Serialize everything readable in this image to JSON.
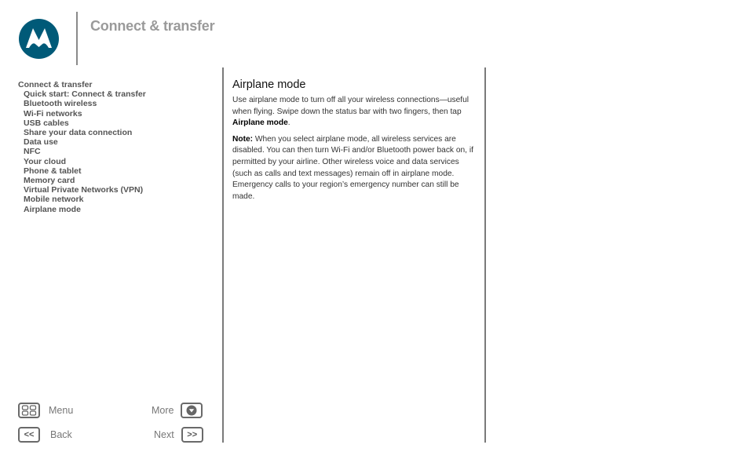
{
  "header": {
    "logo": "motorola-logo",
    "title": "Connect & transfer"
  },
  "toc": {
    "heading": "Connect & transfer",
    "items": [
      "Quick start: Connect & transfer",
      "Bluetooth wireless",
      "Wi-Fi networks",
      "USB cables",
      "Share your data connection",
      "Data use",
      "NFC",
      "Your cloud",
      "Phone & tablet",
      "Memory card",
      "Virtual Private Networks (VPN)",
      "Mobile network",
      "Airplane mode"
    ]
  },
  "content": {
    "title": "Airplane mode",
    "p1_text": "Use airplane mode to turn off all your wireless connections—useful when flying. Swipe down the status bar with two fingers, then tap ",
    "p1_bold": "Airplane mode",
    "p1_end": ".",
    "note_label": "Note:",
    "note_text": " When you select airplane mode, all wireless services are disabled. You can then turn Wi-Fi and/or Bluetooth power back on, if permitted by your airline. Other wireless voice and data services (such as calls and text messages) remain off in airplane mode. Emergency calls to your region’s emergency number can still be made."
  },
  "nav": {
    "menu_label": "Menu",
    "more_label": "More",
    "back_label": "Back",
    "next_label": "Next",
    "back_glyph": "<<",
    "next_glyph": ">>"
  },
  "colors": {
    "brand": "#005a78",
    "title": "#9a9a9a",
    "toc_text": "#545454"
  }
}
